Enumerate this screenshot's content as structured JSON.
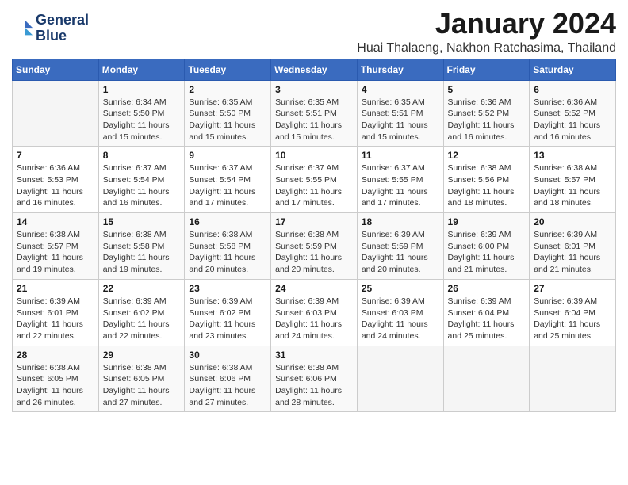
{
  "header": {
    "logo_line1": "General",
    "logo_line2": "Blue",
    "title": "January 2024",
    "subtitle": "Huai Thalaeng, Nakhon Ratchasima, Thailand"
  },
  "columns": [
    "Sunday",
    "Monday",
    "Tuesday",
    "Wednesday",
    "Thursday",
    "Friday",
    "Saturday"
  ],
  "weeks": [
    [
      {
        "num": "",
        "info": ""
      },
      {
        "num": "1",
        "info": "Sunrise: 6:34 AM\nSunset: 5:50 PM\nDaylight: 11 hours\nand 15 minutes."
      },
      {
        "num": "2",
        "info": "Sunrise: 6:35 AM\nSunset: 5:50 PM\nDaylight: 11 hours\nand 15 minutes."
      },
      {
        "num": "3",
        "info": "Sunrise: 6:35 AM\nSunset: 5:51 PM\nDaylight: 11 hours\nand 15 minutes."
      },
      {
        "num": "4",
        "info": "Sunrise: 6:35 AM\nSunset: 5:51 PM\nDaylight: 11 hours\nand 15 minutes."
      },
      {
        "num": "5",
        "info": "Sunrise: 6:36 AM\nSunset: 5:52 PM\nDaylight: 11 hours\nand 16 minutes."
      },
      {
        "num": "6",
        "info": "Sunrise: 6:36 AM\nSunset: 5:52 PM\nDaylight: 11 hours\nand 16 minutes."
      }
    ],
    [
      {
        "num": "7",
        "info": "Sunrise: 6:36 AM\nSunset: 5:53 PM\nDaylight: 11 hours\nand 16 minutes."
      },
      {
        "num": "8",
        "info": "Sunrise: 6:37 AM\nSunset: 5:54 PM\nDaylight: 11 hours\nand 16 minutes."
      },
      {
        "num": "9",
        "info": "Sunrise: 6:37 AM\nSunset: 5:54 PM\nDaylight: 11 hours\nand 17 minutes."
      },
      {
        "num": "10",
        "info": "Sunrise: 6:37 AM\nSunset: 5:55 PM\nDaylight: 11 hours\nand 17 minutes."
      },
      {
        "num": "11",
        "info": "Sunrise: 6:37 AM\nSunset: 5:55 PM\nDaylight: 11 hours\nand 17 minutes."
      },
      {
        "num": "12",
        "info": "Sunrise: 6:38 AM\nSunset: 5:56 PM\nDaylight: 11 hours\nand 18 minutes."
      },
      {
        "num": "13",
        "info": "Sunrise: 6:38 AM\nSunset: 5:57 PM\nDaylight: 11 hours\nand 18 minutes."
      }
    ],
    [
      {
        "num": "14",
        "info": "Sunrise: 6:38 AM\nSunset: 5:57 PM\nDaylight: 11 hours\nand 19 minutes."
      },
      {
        "num": "15",
        "info": "Sunrise: 6:38 AM\nSunset: 5:58 PM\nDaylight: 11 hours\nand 19 minutes."
      },
      {
        "num": "16",
        "info": "Sunrise: 6:38 AM\nSunset: 5:58 PM\nDaylight: 11 hours\nand 20 minutes."
      },
      {
        "num": "17",
        "info": "Sunrise: 6:38 AM\nSunset: 5:59 PM\nDaylight: 11 hours\nand 20 minutes."
      },
      {
        "num": "18",
        "info": "Sunrise: 6:39 AM\nSunset: 5:59 PM\nDaylight: 11 hours\nand 20 minutes."
      },
      {
        "num": "19",
        "info": "Sunrise: 6:39 AM\nSunset: 6:00 PM\nDaylight: 11 hours\nand 21 minutes."
      },
      {
        "num": "20",
        "info": "Sunrise: 6:39 AM\nSunset: 6:01 PM\nDaylight: 11 hours\nand 21 minutes."
      }
    ],
    [
      {
        "num": "21",
        "info": "Sunrise: 6:39 AM\nSunset: 6:01 PM\nDaylight: 11 hours\nand 22 minutes."
      },
      {
        "num": "22",
        "info": "Sunrise: 6:39 AM\nSunset: 6:02 PM\nDaylight: 11 hours\nand 22 minutes."
      },
      {
        "num": "23",
        "info": "Sunrise: 6:39 AM\nSunset: 6:02 PM\nDaylight: 11 hours\nand 23 minutes."
      },
      {
        "num": "24",
        "info": "Sunrise: 6:39 AM\nSunset: 6:03 PM\nDaylight: 11 hours\nand 24 minutes."
      },
      {
        "num": "25",
        "info": "Sunrise: 6:39 AM\nSunset: 6:03 PM\nDaylight: 11 hours\nand 24 minutes."
      },
      {
        "num": "26",
        "info": "Sunrise: 6:39 AM\nSunset: 6:04 PM\nDaylight: 11 hours\nand 25 minutes."
      },
      {
        "num": "27",
        "info": "Sunrise: 6:39 AM\nSunset: 6:04 PM\nDaylight: 11 hours\nand 25 minutes."
      }
    ],
    [
      {
        "num": "28",
        "info": "Sunrise: 6:38 AM\nSunset: 6:05 PM\nDaylight: 11 hours\nand 26 minutes."
      },
      {
        "num": "29",
        "info": "Sunrise: 6:38 AM\nSunset: 6:05 PM\nDaylight: 11 hours\nand 27 minutes."
      },
      {
        "num": "30",
        "info": "Sunrise: 6:38 AM\nSunset: 6:06 PM\nDaylight: 11 hours\nand 27 minutes."
      },
      {
        "num": "31",
        "info": "Sunrise: 6:38 AM\nSunset: 6:06 PM\nDaylight: 11 hours\nand 28 minutes."
      },
      {
        "num": "",
        "info": ""
      },
      {
        "num": "",
        "info": ""
      },
      {
        "num": "",
        "info": ""
      }
    ]
  ]
}
